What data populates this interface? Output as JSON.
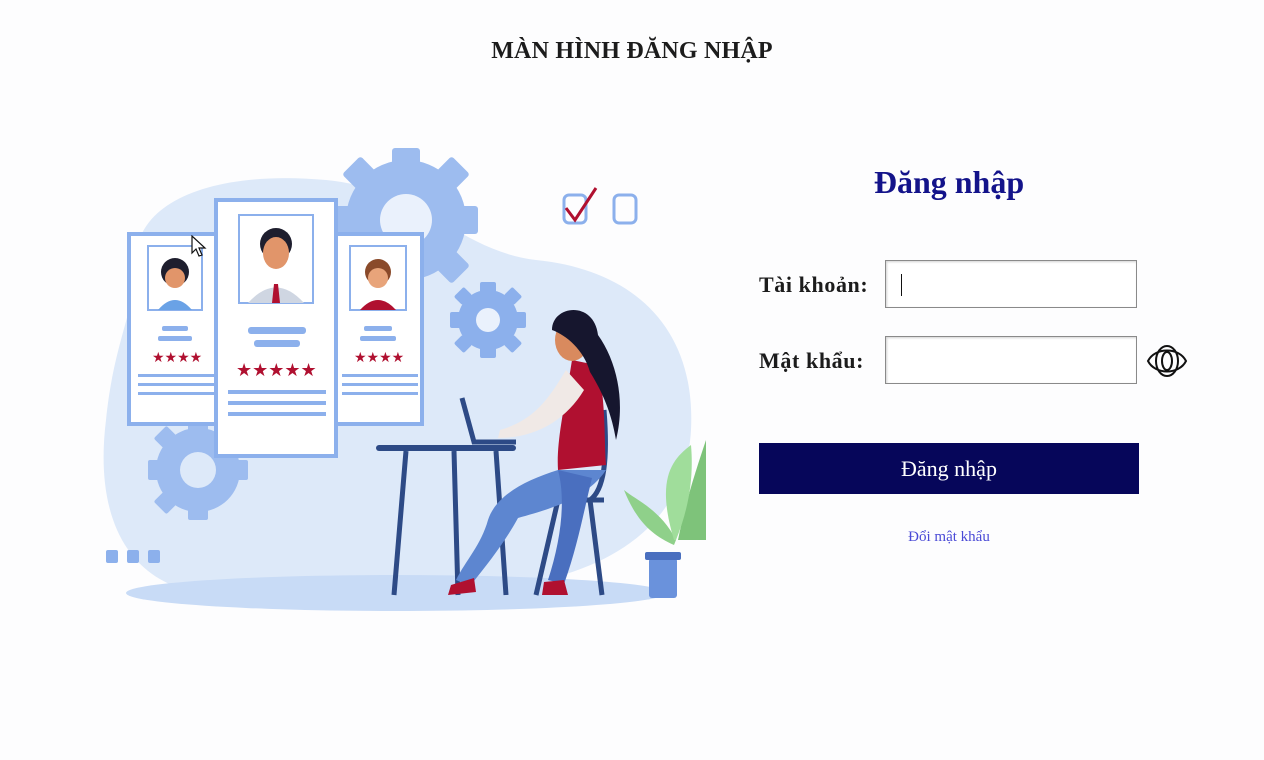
{
  "page": {
    "title": "MÀN HÌNH ĐĂNG NHẬP"
  },
  "login": {
    "heading": "Đăng nhập",
    "username_label": "Tài khoản:",
    "username_value": "",
    "password_label": "Mật khẩu:",
    "password_value": "",
    "submit_label": "Đăng nhập",
    "change_password_link": "Đổi mật khẩu"
  },
  "icons": {
    "password_toggle": "eye-icon"
  },
  "colors": {
    "heading": "#13138a",
    "button_background": "#06065a",
    "link": "#4a4ad6",
    "illustration_light": "#dde9f9",
    "illustration_blue": "#8cb0ec",
    "accent_red": "#b01030"
  }
}
